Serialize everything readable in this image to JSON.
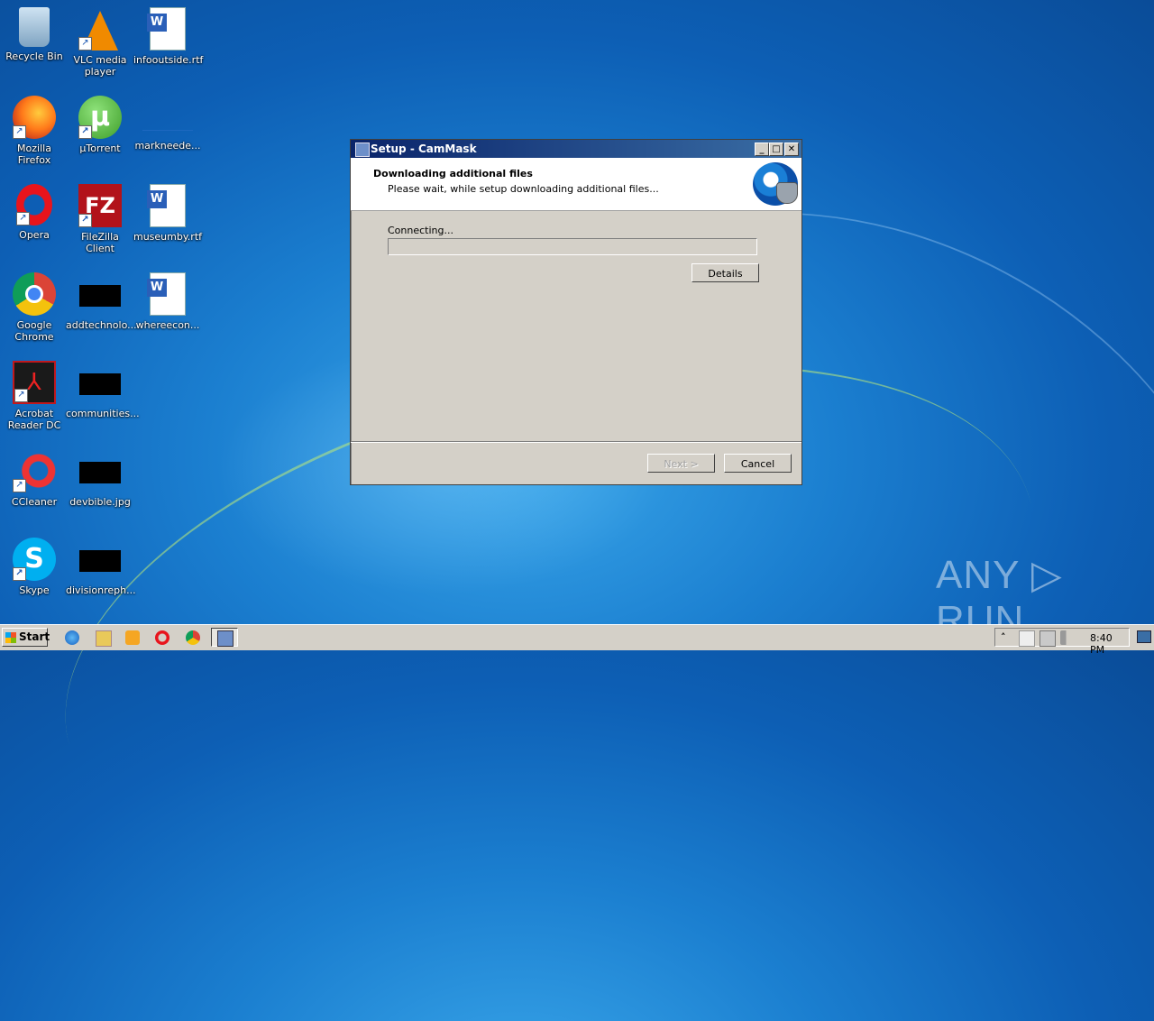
{
  "desktop": {
    "icons": [
      {
        "label": "Recycle Bin"
      },
      {
        "label": "VLC media player"
      },
      {
        "label": "infooutside.rtf"
      },
      {
        "label": "Mozilla Firefox"
      },
      {
        "label": "µTorrent"
      },
      {
        "label": "markneede..."
      },
      {
        "label": "Opera"
      },
      {
        "label": "FileZilla Client"
      },
      {
        "label": "museumby.rtf"
      },
      {
        "label": "Google Chrome"
      },
      {
        "label": "addtechnolo..."
      },
      {
        "label": "whereecon..."
      },
      {
        "label": "Acrobat Reader DC"
      },
      {
        "label": "communities..."
      },
      {
        "label": "CCleaner"
      },
      {
        "label": "devbible.jpg"
      },
      {
        "label": "Skype"
      },
      {
        "label": "divisionreph..."
      }
    ],
    "watermark": "ANY ▷ RUN"
  },
  "dialog": {
    "title": "Setup - CamMask",
    "heading": "Downloading additional files",
    "subheading": "Please wait, while setup downloading additional files...",
    "status": "Connecting...",
    "progress_percent": 0,
    "details_label": "Details",
    "next_label": "Next >",
    "cancel_label": "Cancel",
    "title_buttons": {
      "minimize": "_",
      "maximize": "□",
      "close": "✕"
    }
  },
  "taskbar": {
    "start_label": "Start",
    "clock": "8:40 PM",
    "tray_expand": "˄"
  }
}
